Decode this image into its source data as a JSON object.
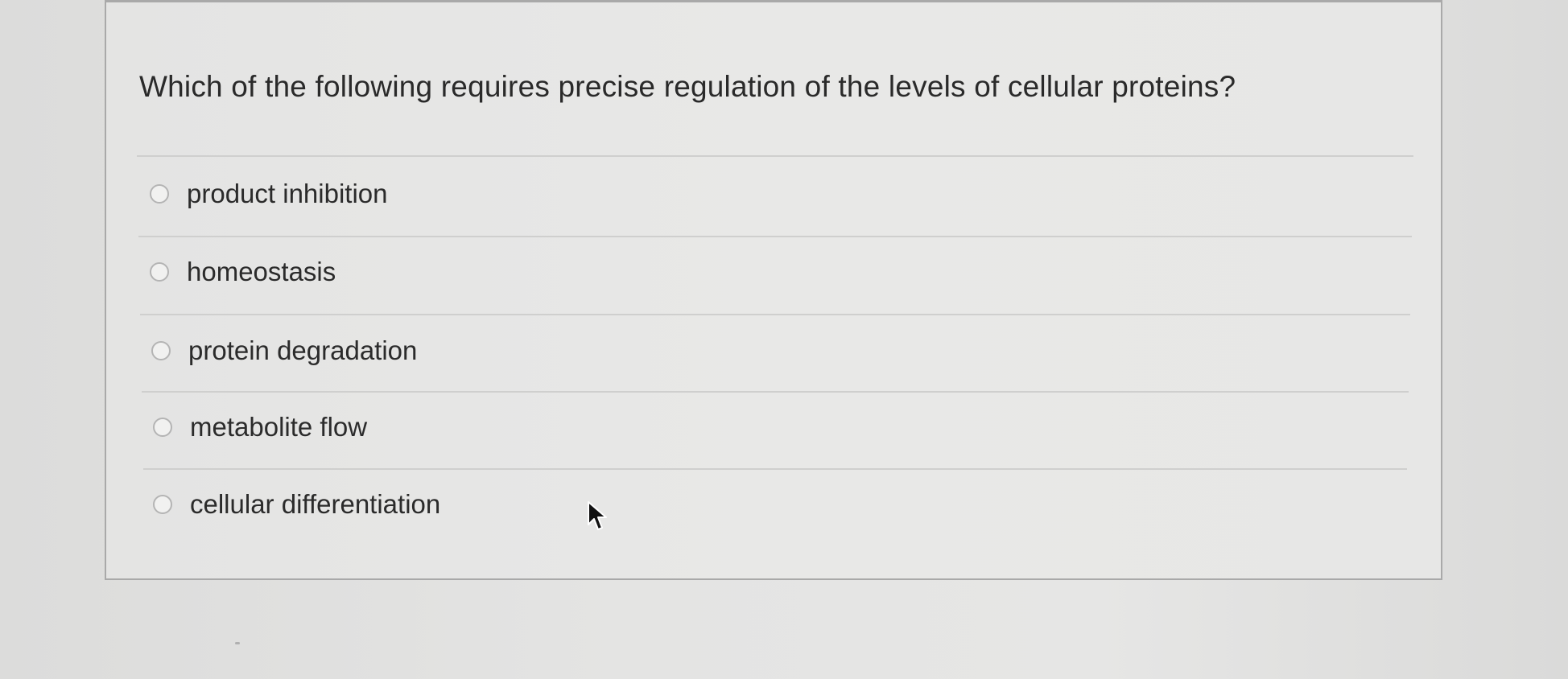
{
  "question": {
    "text": "Which of the following requires precise regulation of the levels of cellular proteins?"
  },
  "options": [
    {
      "label": "product inhibition",
      "selected": false
    },
    {
      "label": "homeostasis",
      "selected": false
    },
    {
      "label": "protein degradation",
      "selected": false
    },
    {
      "label": "metabolite flow",
      "selected": false
    },
    {
      "label": "cellular differentiation",
      "selected": false
    }
  ],
  "icons": {
    "radio": "radio-button-icon",
    "cursor": "mouse-pointer-icon"
  },
  "colors": {
    "background": "#e4e4e3",
    "card_border": "#a9a9a9",
    "text": "#2b2b2b",
    "radio_border": "#b4b4b4",
    "divider": "#cfcfce"
  }
}
